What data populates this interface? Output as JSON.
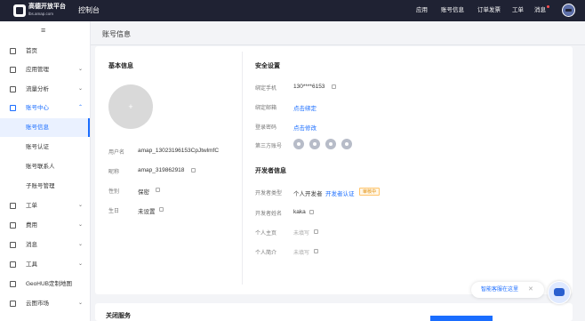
{
  "topbar": {
    "brand": "高德开放平台",
    "brand_sub": "lbs.amap.com",
    "console": "控制台",
    "nav": [
      "应用",
      "账号信息",
      "订单发票",
      "工单",
      "消息"
    ]
  },
  "sidebar": {
    "items": [
      {
        "label": "首页",
        "icon": "home-icon"
      },
      {
        "label": "应用管理",
        "icon": "app-grid-icon"
      },
      {
        "label": "流量分析",
        "icon": "chart-icon"
      },
      {
        "label": "账号中心",
        "icon": "user-icon"
      },
      {
        "label": "工单",
        "icon": "ticket-icon"
      },
      {
        "label": "费用",
        "icon": "billing-icon"
      },
      {
        "label": "消息",
        "icon": "message-icon"
      },
      {
        "label": "工具",
        "icon": "wrench-icon"
      },
      {
        "label": "GeoHUB定制地图",
        "icon": "layers-icon"
      },
      {
        "label": "云图市场",
        "icon": "cloud-icon"
      }
    ],
    "subitems": [
      "账号信息",
      "账号认证",
      "账号联系人",
      "子账号管理"
    ]
  },
  "page": {
    "title": "账号信息"
  },
  "basic": {
    "title": "基本信息",
    "rows": [
      {
        "key": "用户名",
        "value": "amap_13023196153CpJtwlmfC"
      },
      {
        "key": "昵称",
        "value": "amap_319862918"
      },
      {
        "key": "性别",
        "value": "保密"
      },
      {
        "key": "生日",
        "value": "未设置"
      }
    ]
  },
  "security": {
    "title": "安全设置",
    "phone_label": "绑定手机",
    "phone_value": "130****6153",
    "email_label": "绑定邮箱",
    "email_link": "点击绑定",
    "password_label": "登录密码",
    "password_link": "点击修改",
    "thirdparty_label": "第三方账号"
  },
  "developer": {
    "title": "开发者信息",
    "type_label": "开发者类型",
    "type_value": "个人开发者",
    "auth_link": "开发者认证",
    "auth_badge": "审核中",
    "name_label": "开发者姓名",
    "name_value": "kaka",
    "homepage_label": "个人主页",
    "homepage_value": "未填写",
    "intro_label": "个人简介",
    "intro_value": "未填写"
  },
  "service": {
    "title": "关闭服务"
  },
  "support": {
    "text": "智能客服在这里",
    "close": "✕"
  },
  "colors": {
    "accent": "#1a6dff",
    "topbar": "#1f2233",
    "badge": "#e08a00"
  }
}
